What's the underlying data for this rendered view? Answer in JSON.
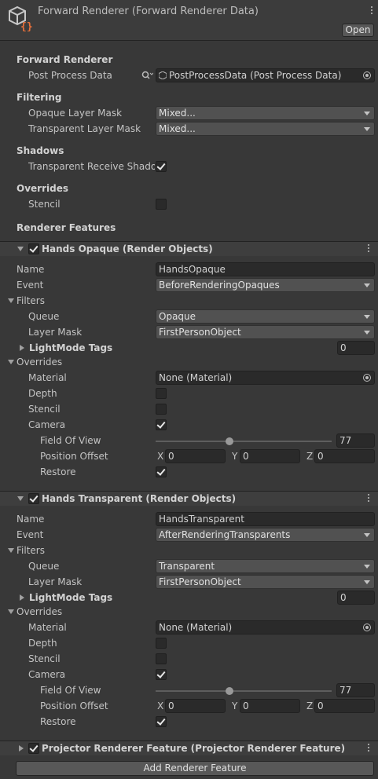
{
  "header": {
    "title": "Forward Renderer (Forward Renderer Data)",
    "open_label": "Open"
  },
  "forward_renderer": {
    "section": "Forward Renderer",
    "post_process_label": "Post Process Data",
    "post_process_value": "PostProcessData (Post Process Data)"
  },
  "filtering": {
    "section": "Filtering",
    "opaque_label": "Opaque Layer Mask",
    "opaque_value": "Mixed...",
    "transparent_label": "Transparent Layer Mask",
    "transparent_value": "Mixed..."
  },
  "shadows": {
    "section": "Shadows",
    "receive_label": "Transparent Receive Shadows",
    "receive_checked": true
  },
  "overrides": {
    "section": "Overrides",
    "stencil_label": "Stencil",
    "stencil_checked": false
  },
  "renderer_features_title": "Renderer Features",
  "features": [
    {
      "title": "Hands Opaque (Render Objects)",
      "enabled": true,
      "name_label": "Name",
      "name_value": "HandsOpaque",
      "event_label": "Event",
      "event_value": "BeforeRenderingOpaques",
      "filters_label": "Filters",
      "queue_label": "Queue",
      "queue_value": "Opaque",
      "layer_label": "Layer Mask",
      "layer_value": "FirstPersonObject",
      "lightmode_label": "LightMode Tags",
      "lightmode_value": "0",
      "overrides_label": "Overrides",
      "material_label": "Material",
      "material_value": "None (Material)",
      "depth_label": "Depth",
      "depth_checked": false,
      "stencil_label": "Stencil",
      "stencil_checked": false,
      "camera_label": "Camera",
      "camera_checked": true,
      "fov_label": "Field Of View",
      "fov_value": "77",
      "fov_fraction": 0.42,
      "offset_label": "Position Offset",
      "x_label": "X",
      "x_value": "0",
      "y_label": "Y",
      "y_value": "0",
      "z_label": "Z",
      "z_value": "0",
      "restore_label": "Restore",
      "restore_checked": true
    },
    {
      "title": "Hands Transparent (Render Objects)",
      "enabled": true,
      "name_label": "Name",
      "name_value": "HandsTransparent",
      "event_label": "Event",
      "event_value": "AfterRenderingTransparents",
      "filters_label": "Filters",
      "queue_label": "Queue",
      "queue_value": "Transparent",
      "layer_label": "Layer Mask",
      "layer_value": "FirstPersonObject",
      "lightmode_label": "LightMode Tags",
      "lightmode_value": "0",
      "overrides_label": "Overrides",
      "material_label": "Material",
      "material_value": "None (Material)",
      "depth_label": "Depth",
      "depth_checked": false,
      "stencil_label": "Stencil",
      "stencil_checked": false,
      "camera_label": "Camera",
      "camera_checked": true,
      "fov_label": "Field Of View",
      "fov_value": "77",
      "fov_fraction": 0.42,
      "offset_label": "Position Offset",
      "x_label": "X",
      "x_value": "0",
      "y_label": "Y",
      "y_value": "0",
      "z_label": "Z",
      "z_value": "0",
      "restore_label": "Restore",
      "restore_checked": true
    },
    {
      "title": "Projector Renderer Feature (Projector Renderer Feature)",
      "enabled": true
    }
  ],
  "add_feature_label": "Add Renderer Feature",
  "icons": {
    "asset": "scriptable-object-icon",
    "search": "search-icon",
    "menu": "kebab-menu-icon"
  }
}
